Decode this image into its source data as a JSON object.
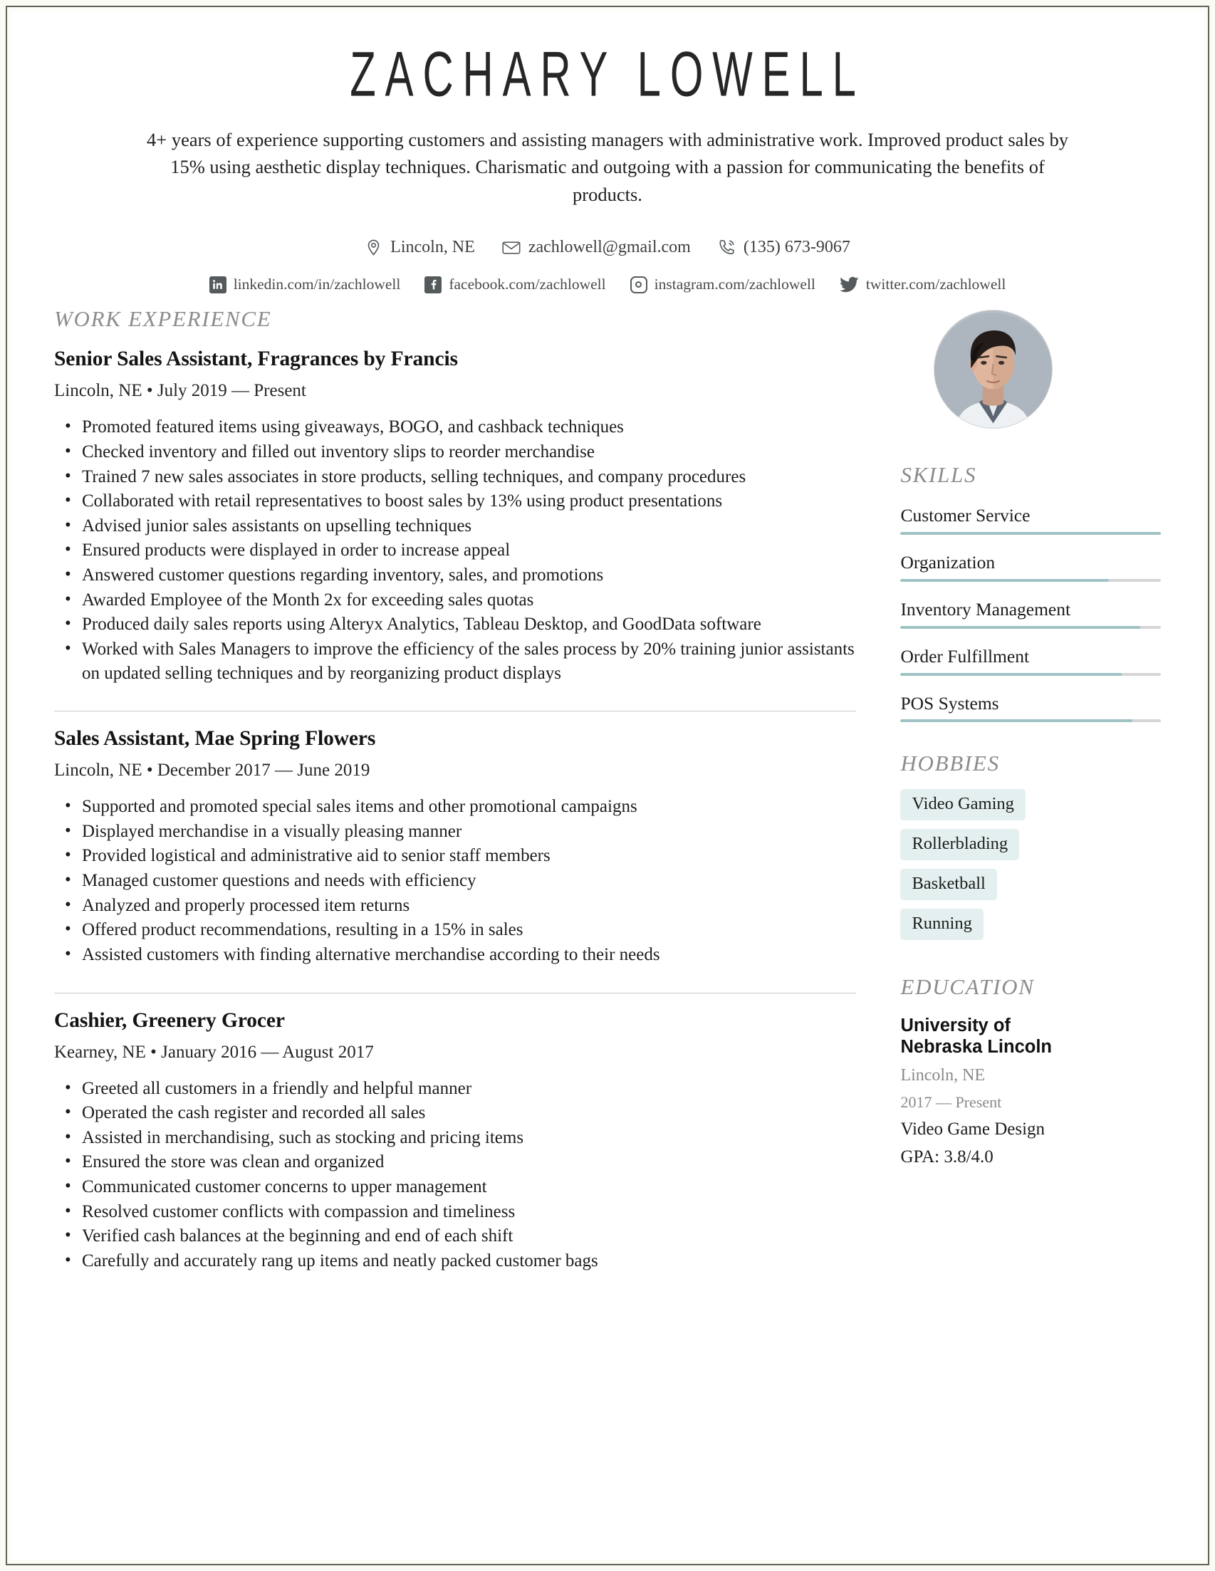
{
  "header": {
    "name": "ZACHARY LOWELL",
    "summary": "4+ years of experience supporting customers and assisting managers with administrative work. Improved product sales by 15% using aesthetic display techniques. Charismatic and outgoing with a passion for communicating the benefits of products."
  },
  "contact": {
    "location": "Lincoln, NE",
    "email": "zachlowell@gmail.com",
    "phone": "(135) 673-9067"
  },
  "social": {
    "linkedin": "linkedin.com/in/zachlowell",
    "facebook": "facebook.com/zachlowell",
    "instagram": "instagram.com/zachlowell",
    "twitter": "twitter.com/zachlowell"
  },
  "sections": {
    "work": "WORK EXPERIENCE",
    "skills": "SKILLS",
    "hobbies": "HOBBIES",
    "education": "EDUCATION"
  },
  "jobs": [
    {
      "title": "Senior Sales Assistant, Fragrances by Francis",
      "meta": "Lincoln, NE • July 2019 — Present",
      "bullets": [
        "Promoted featured items using giveaways, BOGO, and cashback techniques",
        "Checked inventory and filled out inventory slips to reorder merchandise",
        "Trained 7 new sales associates in store products, selling techniques, and company procedures",
        "Collaborated with retail representatives to boost sales by 13% using product presentations",
        "Advised junior sales assistants on upselling techniques",
        "Ensured products were displayed in order to increase appeal",
        "Answered customer questions regarding inventory, sales, and promotions",
        "Awarded Employee of the Month 2x for exceeding sales quotas",
        "Produced daily sales reports using Alteryx Analytics, Tableau Desktop, and GoodData software",
        "Worked with Sales Managers to improve the efficiency of the sales process by 20% training junior assistants on updated selling techniques and by reorganizing product displays"
      ]
    },
    {
      "title": "Sales Assistant, Mae Spring Flowers",
      "meta": "Lincoln, NE • December 2017 — June 2019",
      "bullets": [
        "Supported and promoted special sales items and other promotional campaigns",
        "Displayed merchandise in a visually pleasing manner",
        "Provided logistical and administrative aid to senior staff members",
        "Managed customer questions and needs with efficiency",
        "Analyzed and properly processed item returns",
        "Offered product recommendations, resulting in a 15% in sales",
        "Assisted customers with finding alternative merchandise according to their needs"
      ]
    },
    {
      "title": "Cashier, Greenery Grocer",
      "meta": "Kearney, NE • January 2016 — August 2017",
      "bullets": [
        "Greeted all customers in a friendly and helpful manner",
        "Operated the cash register and recorded all sales",
        "Assisted in merchandising, such as stocking and pricing items",
        "Ensured the store was clean and organized",
        "Communicated customer concerns to upper management",
        "Resolved customer conflicts with compassion and timeliness",
        "Verified cash balances at the beginning and end of each shift",
        "Carefully and accurately rang up items and neatly packed customer bags"
      ]
    }
  ],
  "skills": [
    {
      "label": "Customer Service",
      "level": 100
    },
    {
      "label": "Organization",
      "level": 80
    },
    {
      "label": "Inventory Management",
      "level": 92
    },
    {
      "label": "Order Fulfillment",
      "level": 85
    },
    {
      "label": "POS Systems",
      "level": 89
    }
  ],
  "hobbies": [
    "Video Gaming",
    "Rollerblading",
    "Basketball",
    "Running"
  ],
  "education": {
    "school": "University of Nebraska Lincoln",
    "location": "Lincoln, NE",
    "dates": "2017 — Present",
    "program": "Video Game Design",
    "gpa": "GPA: 3.8/4.0"
  },
  "colors": {
    "accent_teal": "#9fc3c4",
    "tag_bg": "#e4f0ef",
    "heading_gray": "#8c8c8c",
    "frame": "#5e6356"
  }
}
